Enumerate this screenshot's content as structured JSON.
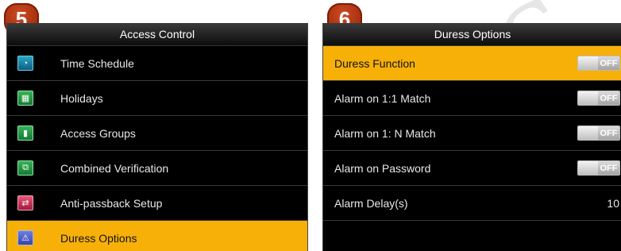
{
  "steps": {
    "left": "5",
    "right": "6"
  },
  "access_control": {
    "title": "Access Control",
    "items": [
      {
        "label": "Time Schedule",
        "icon": "clock-icon"
      },
      {
        "label": "Holidays",
        "icon": "calendar-icon"
      },
      {
        "label": "Access Groups",
        "icon": "door-icon"
      },
      {
        "label": "Combined Verification",
        "icon": "combined-verification-icon"
      },
      {
        "label": "Anti-passback Setup",
        "icon": "anti-passback-icon"
      },
      {
        "label": "Duress Options",
        "icon": "duress-icon",
        "selected": true
      }
    ]
  },
  "duress_options": {
    "title": "Duress Options",
    "items": [
      {
        "label": "Duress Function",
        "state": "OFF",
        "selected": true
      },
      {
        "label": "Alarm on 1:1 Match",
        "state": "OFF"
      },
      {
        "label": "Alarm on 1: N Match",
        "state": "OFF"
      },
      {
        "label": "Alarm on Password",
        "state": "OFF"
      },
      {
        "label": "Alarm Delay(s)",
        "value": "10"
      }
    ]
  },
  "colors": {
    "selected_row": "#f7b008",
    "badge": "#b8360f"
  }
}
